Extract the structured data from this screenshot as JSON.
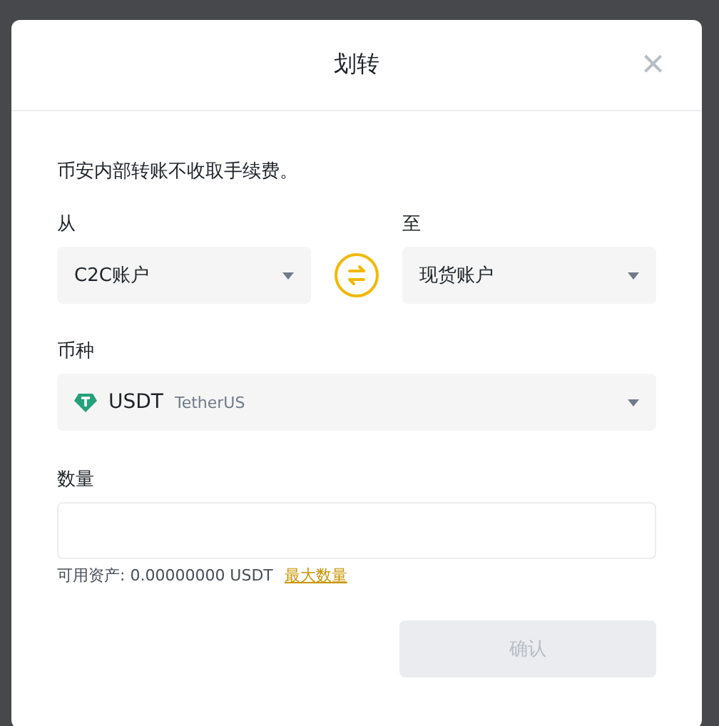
{
  "dialog": {
    "title": "划转",
    "close": "×"
  },
  "notice": "币安内部转账不收取手续费。",
  "from": {
    "label": "从",
    "value": "C2C账户"
  },
  "to": {
    "label": "至",
    "value": "现货账户"
  },
  "coin": {
    "label": "币种",
    "symbol": "USDT",
    "name": "TetherUS"
  },
  "amount": {
    "label": "数量",
    "available": "可用资产: 0.00000000 USDT",
    "max_link": "最大数量"
  },
  "confirm": {
    "label": "确认",
    "disabled": true
  }
}
